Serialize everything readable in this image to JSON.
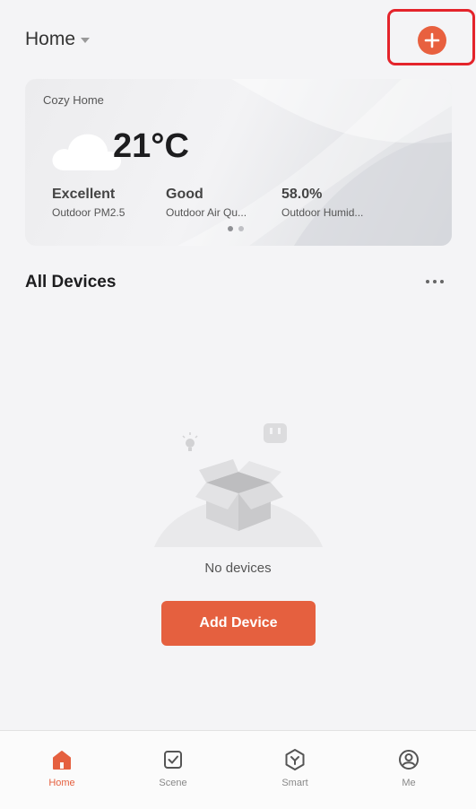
{
  "header": {
    "home_title": "Home"
  },
  "weather": {
    "home_name": "Cozy Home",
    "temperature": "21°C",
    "metrics": [
      {
        "value": "Excellent",
        "label": "Outdoor PM2.5"
      },
      {
        "value": "Good",
        "label": "Outdoor Air Qu..."
      },
      {
        "value": "58.0%",
        "label": "Outdoor Humid..."
      }
    ],
    "page_indicator": {
      "pages": 2,
      "active": 1
    }
  },
  "devices": {
    "section_title": "All Devices",
    "empty_text": "No devices",
    "add_button": "Add Device"
  },
  "tabs": [
    {
      "label": "Home",
      "icon": "home-icon",
      "active": true
    },
    {
      "label": "Scene",
      "icon": "scene-checkbox-icon",
      "active": false
    },
    {
      "label": "Smart",
      "icon": "smart-hexagon-icon",
      "active": false
    },
    {
      "label": "Me",
      "icon": "profile-icon",
      "active": false
    }
  ],
  "colors": {
    "accent": "#e5603f",
    "highlight": "#e4242b",
    "background": "#f4f4f6"
  }
}
